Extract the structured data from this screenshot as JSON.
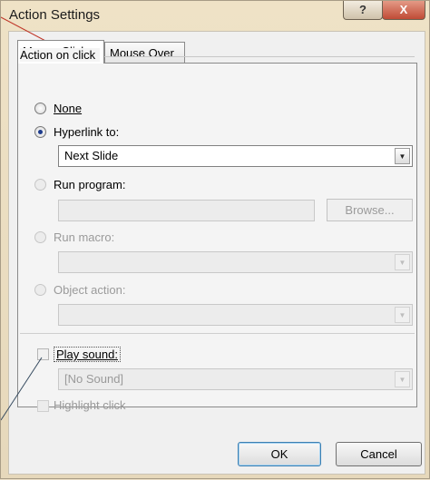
{
  "window": {
    "title": "Action Settings",
    "help_glyph": "?",
    "close_glyph": "X"
  },
  "tabs": [
    "Mouse Click",
    "Mouse Over"
  ],
  "group": {
    "label": "Action on click"
  },
  "options": {
    "none": "None",
    "hyperlink": "Hyperlink to:",
    "hyperlink_value": "Next Slide",
    "run_program": "Run program:",
    "run_program_value": "",
    "browse": "Browse...",
    "run_macro": "Run macro:",
    "run_macro_value": "",
    "object_action": "Object action:",
    "object_action_value": "",
    "play_sound": "Play sound:",
    "sound_value": "[No Sound]",
    "highlight_click": "Highlight click"
  },
  "buttons": {
    "ok": "OK",
    "cancel": "Cancel"
  },
  "icons": {
    "dropdown": "dropdown-arrow-icon"
  }
}
